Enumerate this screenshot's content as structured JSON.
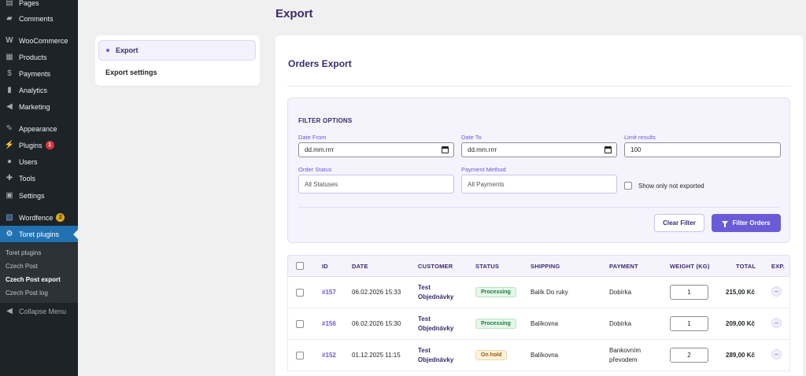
{
  "sidebar": {
    "items": [
      {
        "label": "Pages",
        "icon": "pages-icon",
        "glyph": "▤"
      },
      {
        "label": "Comments",
        "icon": "comments-icon",
        "glyph": "▰"
      },
      {
        "label": "WooCommerce",
        "icon": "woocommerce-icon",
        "glyph": "W"
      },
      {
        "label": "Products",
        "icon": "products-icon",
        "glyph": "▦"
      },
      {
        "label": "Payments",
        "icon": "payments-icon",
        "glyph": "$"
      },
      {
        "label": "Analytics",
        "icon": "analytics-icon",
        "glyph": "▮"
      },
      {
        "label": "Marketing",
        "icon": "marketing-icon",
        "glyph": "◀"
      },
      {
        "label": "Appearance",
        "icon": "appearance-icon",
        "glyph": "✎"
      },
      {
        "label": "Plugins",
        "icon": "plugins-icon",
        "glyph": "⚡",
        "badge": "1"
      },
      {
        "label": "Users",
        "icon": "users-icon",
        "glyph": "●"
      },
      {
        "label": "Tools",
        "icon": "tools-icon",
        "glyph": "✚"
      },
      {
        "label": "Settings",
        "icon": "settings-icon",
        "glyph": "▣"
      },
      {
        "label": "Wordfence",
        "icon": "wordfence-icon",
        "glyph": "▧",
        "badge": "2"
      },
      {
        "label": "Toret plugins",
        "icon": "toret-gear-icon",
        "glyph": "⚙"
      }
    ],
    "submenu": [
      "Toret plugins",
      "Czech Post",
      "Czech Post export",
      "Czech Post log"
    ],
    "collapse_label": "Collapse Menu"
  },
  "page_title": "Export",
  "nav": {
    "items": [
      "Export",
      "Export settings"
    ]
  },
  "card_title": "Orders Export",
  "filter": {
    "title": "FILTER OPTIONS",
    "date_from_label": "Date From",
    "date_from_value": "dd.mm.rrrr",
    "date_to_label": "Date To",
    "date_to_value": "dd.mm.rrrr",
    "limit_label": "Limit results",
    "limit_value": "100",
    "status_label": "Order Status",
    "status_value": "All Statuses",
    "payment_label": "Payment Method",
    "payment_value": "All Payments",
    "only_not_exported": "Show only not exported",
    "clear_button": "Clear Filter",
    "filter_button": "Filter Orders"
  },
  "table": {
    "headers": [
      "ID",
      "DATE",
      "CUSTOMER",
      "STATUS",
      "SHIPPING",
      "PAYMENT",
      "WEIGHT (KG)",
      "TOTAL",
      "EXP."
    ],
    "rows": [
      {
        "id": "#157",
        "date": "06.02.2026 15:33",
        "customer1": "Test",
        "customer2": "Objednávky",
        "status": "Processing",
        "shipping": "Balík Do ruky",
        "payment1": "Dobírka",
        "payment2": "",
        "weight": "1",
        "total": "215,00 Kč",
        "exp": "–"
      },
      {
        "id": "#156",
        "date": "06.02.2026 15:30",
        "customer1": "Test",
        "customer2": "Objednávky",
        "status": "Processing",
        "shipping": "Balíkovna",
        "payment1": "Dobírka",
        "payment2": "",
        "weight": "1",
        "total": "209,00 Kč",
        "exp": "–"
      },
      {
        "id": "#152",
        "date": "01.12.2025 11:15",
        "customer1": "Test",
        "customer2": "Objednávky",
        "status": "On hold",
        "shipping": "Balíkovna",
        "payment1": "Bankovním",
        "payment2": "převodem",
        "weight": "2",
        "total": "289,00 Kč",
        "exp": "–"
      }
    ]
  }
}
